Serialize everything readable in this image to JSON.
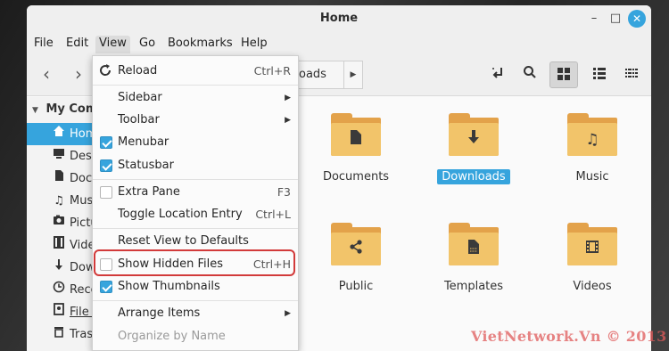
{
  "window": {
    "title": "Home"
  },
  "window_controls": {
    "minimize": "–",
    "maximize": "□",
    "close": "✕"
  },
  "menubar": {
    "items": [
      "File",
      "Edit",
      "View",
      "Go",
      "Bookmarks",
      "Help"
    ],
    "active": "View"
  },
  "toolbar": {
    "back_glyph": "‹",
    "forward_glyph": "›",
    "path_visible_text": "oads",
    "path_arrow_glyph": "▶",
    "icons": [
      "toggle-location-icon",
      "search-icon",
      "icon-view-icon",
      "list-view-icon",
      "compact-view-icon"
    ]
  },
  "sidebar": {
    "section": "My Com",
    "items": [
      {
        "label": "Home",
        "icon": "home-icon",
        "selected": true
      },
      {
        "label": "Desk",
        "icon": "desktop-icon"
      },
      {
        "label": "Docu",
        "icon": "documents-icon"
      },
      {
        "label": "Musi",
        "icon": "music-icon"
      },
      {
        "label": "Pictu",
        "icon": "pictures-icon"
      },
      {
        "label": "Vide",
        "icon": "videos-icon"
      },
      {
        "label": "Dow",
        "icon": "downloads-icon"
      },
      {
        "label": "Rece",
        "icon": "recent-icon"
      },
      {
        "label": "File S",
        "icon": "filesystem-icon"
      },
      {
        "label": "Tras",
        "icon": "trash-icon"
      }
    ]
  },
  "files": [
    {
      "name": "Documents",
      "icon": "document-icon"
    },
    {
      "name": "Downloads",
      "icon": "download-icon",
      "selected": true
    },
    {
      "name": "Music",
      "icon": "music-note-icon"
    },
    {
      "name": "Public",
      "icon": "share-icon"
    },
    {
      "name": "Templates",
      "icon": "template-icon"
    },
    {
      "name": "Videos",
      "icon": "film-icon"
    }
  ],
  "view_menu": {
    "reload": {
      "label": "Reload",
      "accel": "Ctrl+R"
    },
    "sidebar": {
      "label": "Sidebar"
    },
    "toolbar": {
      "label": "Toolbar"
    },
    "menubar": {
      "label": "Menubar",
      "checked": true
    },
    "statusbar": {
      "label": "Statusbar",
      "checked": true
    },
    "extra_pane": {
      "label": "Extra Pane",
      "accel": "F3",
      "checked": false
    },
    "toggle_location": {
      "label": "Toggle Location Entry",
      "accel": "Ctrl+L"
    },
    "reset_view": {
      "label": "Reset View to Defaults"
    },
    "show_hidden": {
      "label": "Show Hidden Files",
      "accel": "Ctrl+H",
      "checked": false,
      "highlighted": true
    },
    "show_thumbnails": {
      "label": "Show Thumbnails",
      "checked": true
    },
    "arrange_items": {
      "label": "Arrange Items"
    },
    "organize_by_name": {
      "label": "Organize by Name",
      "disabled": true
    }
  },
  "watermark": {
    "text": "VietNetwork.Vn © 2013"
  },
  "colors": {
    "accent": "#36a4dd",
    "folder_back": "#e3a24a",
    "folder_front": "#f2c46a",
    "highlight_border": "#d23a3a"
  }
}
